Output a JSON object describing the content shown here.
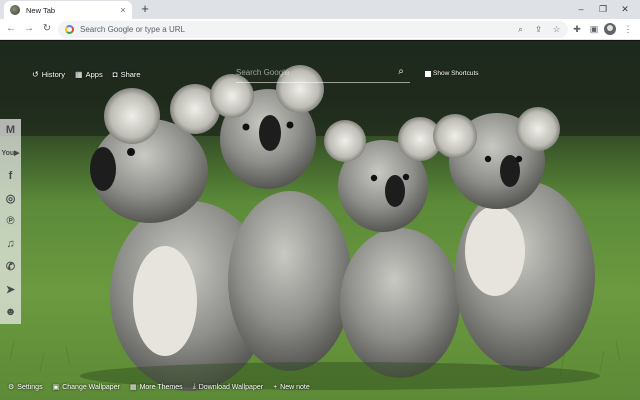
{
  "browser": {
    "tab": {
      "title": "New Tab",
      "close_icon": "×"
    },
    "new_tab_icon": "+",
    "window": {
      "minimize_icon": "–",
      "maximize_icon": "❐",
      "close_icon": "✕"
    },
    "omnibox": {
      "placeholder": "Search Google or type a URL"
    }
  },
  "page": {
    "topnav": [
      {
        "label": "History",
        "icon": "history-icon"
      },
      {
        "label": "Apps",
        "icon": "apps-grid-icon"
      },
      {
        "label": "Share",
        "icon": "share-icon"
      }
    ],
    "search": {
      "placeholder": "Search Google"
    },
    "show_shortcuts": {
      "label": "Show Shortcuts"
    },
    "social": [
      "gmail",
      "youtube",
      "facebook",
      "instagram",
      "pinterest",
      "twitter",
      "whatsapp",
      "telegram",
      "reddit"
    ],
    "bottombar": [
      {
        "label": "Settings",
        "icon": "gear-icon"
      },
      {
        "label": "Change Wallpaper",
        "icon": "wallpaper-icon"
      },
      {
        "label": "More Themes",
        "icon": "grid-icon"
      },
      {
        "label": "Download Wallpaper",
        "icon": "download-icon"
      },
      {
        "label": "New note",
        "icon": "plus-icon"
      }
    ]
  }
}
